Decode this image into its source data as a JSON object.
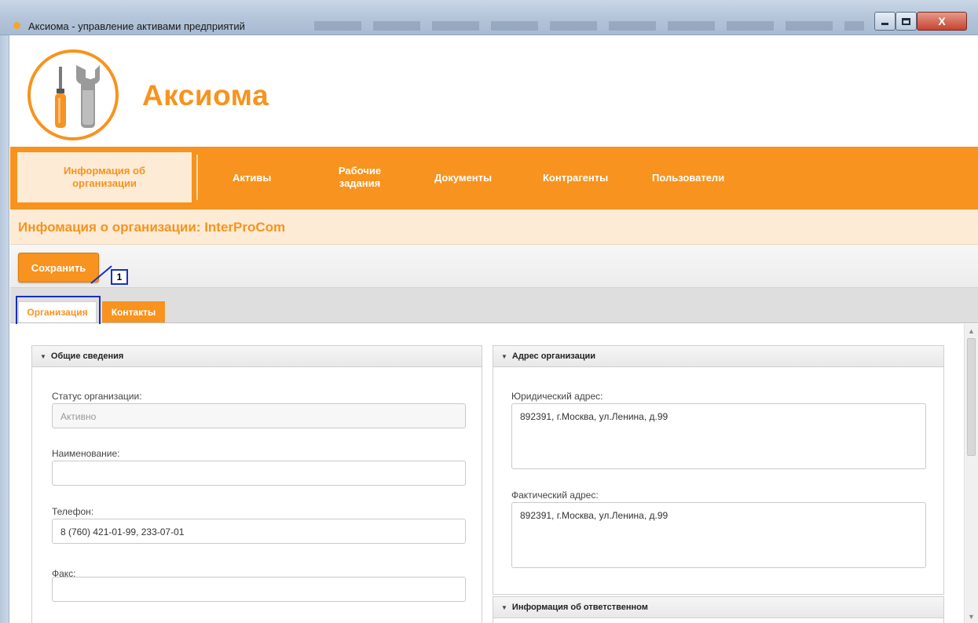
{
  "window": {
    "title": "Аксиома - управление активами предприятий",
    "close_glyph": "X"
  },
  "brand": {
    "name": "Аксиома",
    "logo_icon": "tools-icon",
    "accent_color": "#f7931e"
  },
  "nav": {
    "items": [
      {
        "label": "Информация об организации",
        "active": true
      },
      {
        "label": "Активы"
      },
      {
        "label": "Рабочие задания"
      },
      {
        "label": "Документы"
      },
      {
        "label": "Контрагенты"
      },
      {
        "label": "Пользователи"
      }
    ]
  },
  "page": {
    "title": "Инфомация о организации: InterProCom"
  },
  "toolbar": {
    "save_label": "Сохранить"
  },
  "tabs": [
    {
      "label": "Организация",
      "active": true
    },
    {
      "label": "Контакты"
    }
  ],
  "callout": {
    "number": "1"
  },
  "panels": {
    "general": {
      "title": "Общие сведения",
      "fields": [
        {
          "label": "Статус организации:",
          "value": "Активно"
        },
        {
          "label": "Наименование:",
          "value": ""
        },
        {
          "label": "Телефон:",
          "value": "8 (760) 421-01-99, 233-07-01"
        },
        {
          "label": "Факс:",
          "value": ""
        }
      ]
    },
    "address": {
      "title": "Адрес организации",
      "fields": [
        {
          "label": "Юридический адрес:",
          "value": "892391, г.Москва, ул.Ленина, д.99"
        },
        {
          "label": "Фактический адрес:",
          "value": "892391, г.Москва, ул.Ленина, д.99"
        }
      ]
    },
    "responsible": {
      "title": "Информация об ответственном"
    }
  }
}
